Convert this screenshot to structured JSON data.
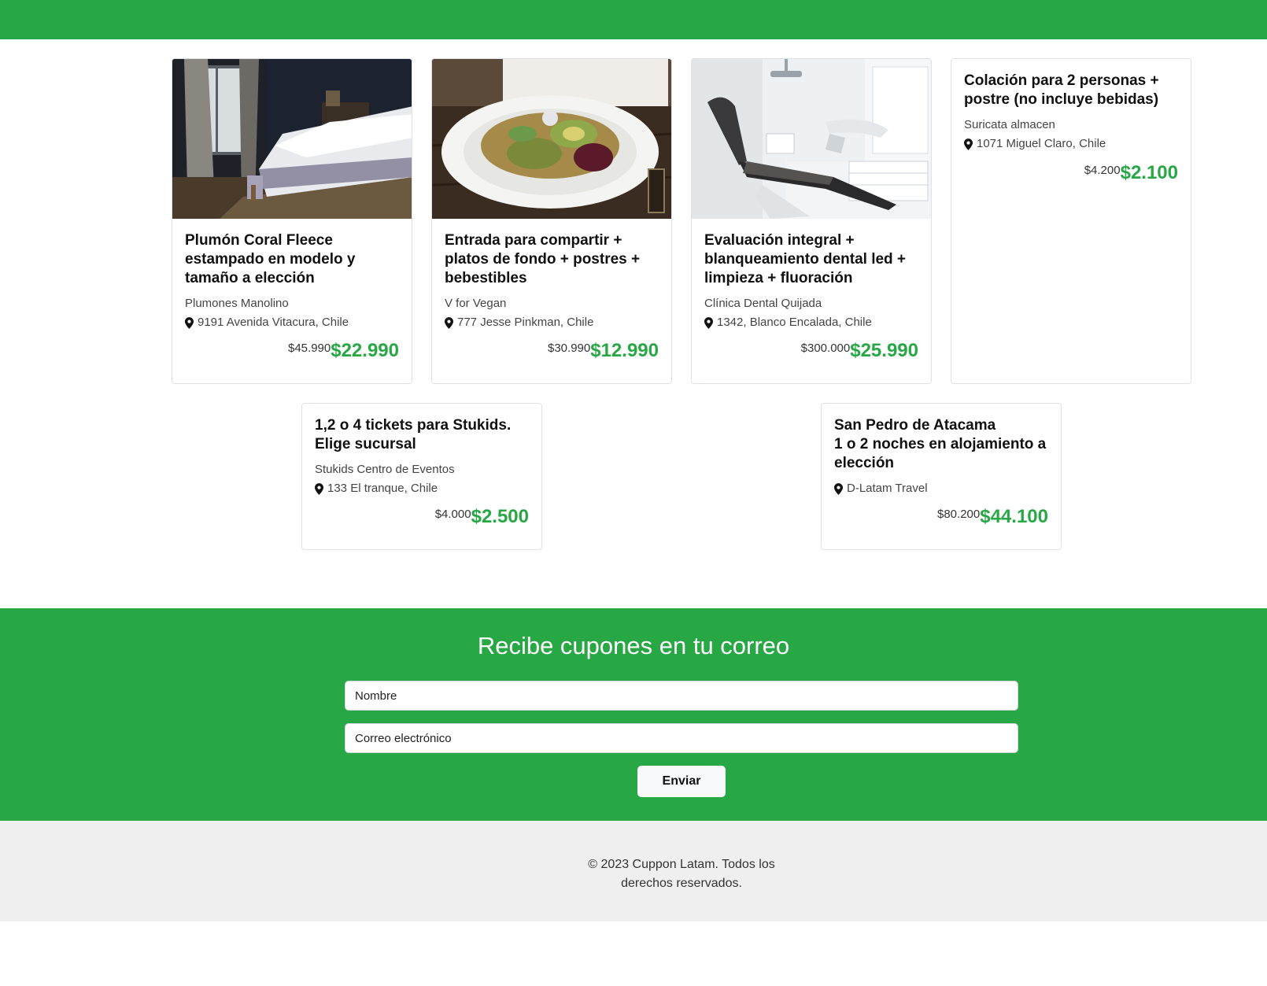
{
  "colors": {
    "brand": "#28a745",
    "footer_bg": "#efefef"
  },
  "deals_row1": [
    {
      "title": "Plumón Coral Fleece estampado en modelo y tamaño a elección",
      "merchant": "Plumones Manolino",
      "location": "9191 Avenida Vitacura, Chile",
      "old_price": "$45.990",
      "new_price": "$22.990",
      "image": "bedroom-bed-photo"
    },
    {
      "title": "Entrada para compartir + platos de fondo + postres + bebestibles",
      "merchant": "V for Vegan",
      "location": "777 Jesse Pinkman, Chile",
      "old_price": "$30.990",
      "new_price": "$12.990",
      "image": "vegan-salad-photo"
    },
    {
      "title": "Evaluación integral + blanqueamiento dental led + limpieza + fluoración",
      "merchant": "Clínica Dental Quijada",
      "location": "1342, Blanco Encalada, Chile",
      "old_price": "$300.000",
      "new_price": "$25.990",
      "image": "dental-chair-photo"
    },
    {
      "title": "Colación para 2 personas + postre (no incluye bebidas)",
      "merchant": "Suricata almacen",
      "location": "1071 Miguel Claro, Chile",
      "old_price": "$4.200",
      "new_price": "$2.100"
    }
  ],
  "deals_row2": [
    {
      "title": "1,2 o 4 tickets para Stukids. Elige sucursal",
      "merchant": "Stukids Centro de Eventos",
      "location": "133 El tranque, Chile",
      "old_price": "$4.000",
      "new_price": "$2.500"
    },
    {
      "title_line1": "San Pedro de Atacama",
      "title_line2": "1 o 2 noches en alojamiento a elección",
      "location": "D-Latam Travel",
      "old_price": "$80.200",
      "new_price": "$44.100"
    }
  ],
  "newsletter": {
    "heading": "Recibe cupones en tu correo",
    "name_placeholder": "Nombre",
    "email_placeholder": "Correo electrónico",
    "submit_label": "Enviar"
  },
  "footer": {
    "copyright": "© 2023 Cuppon Latam. Todos los derechos reservados."
  }
}
